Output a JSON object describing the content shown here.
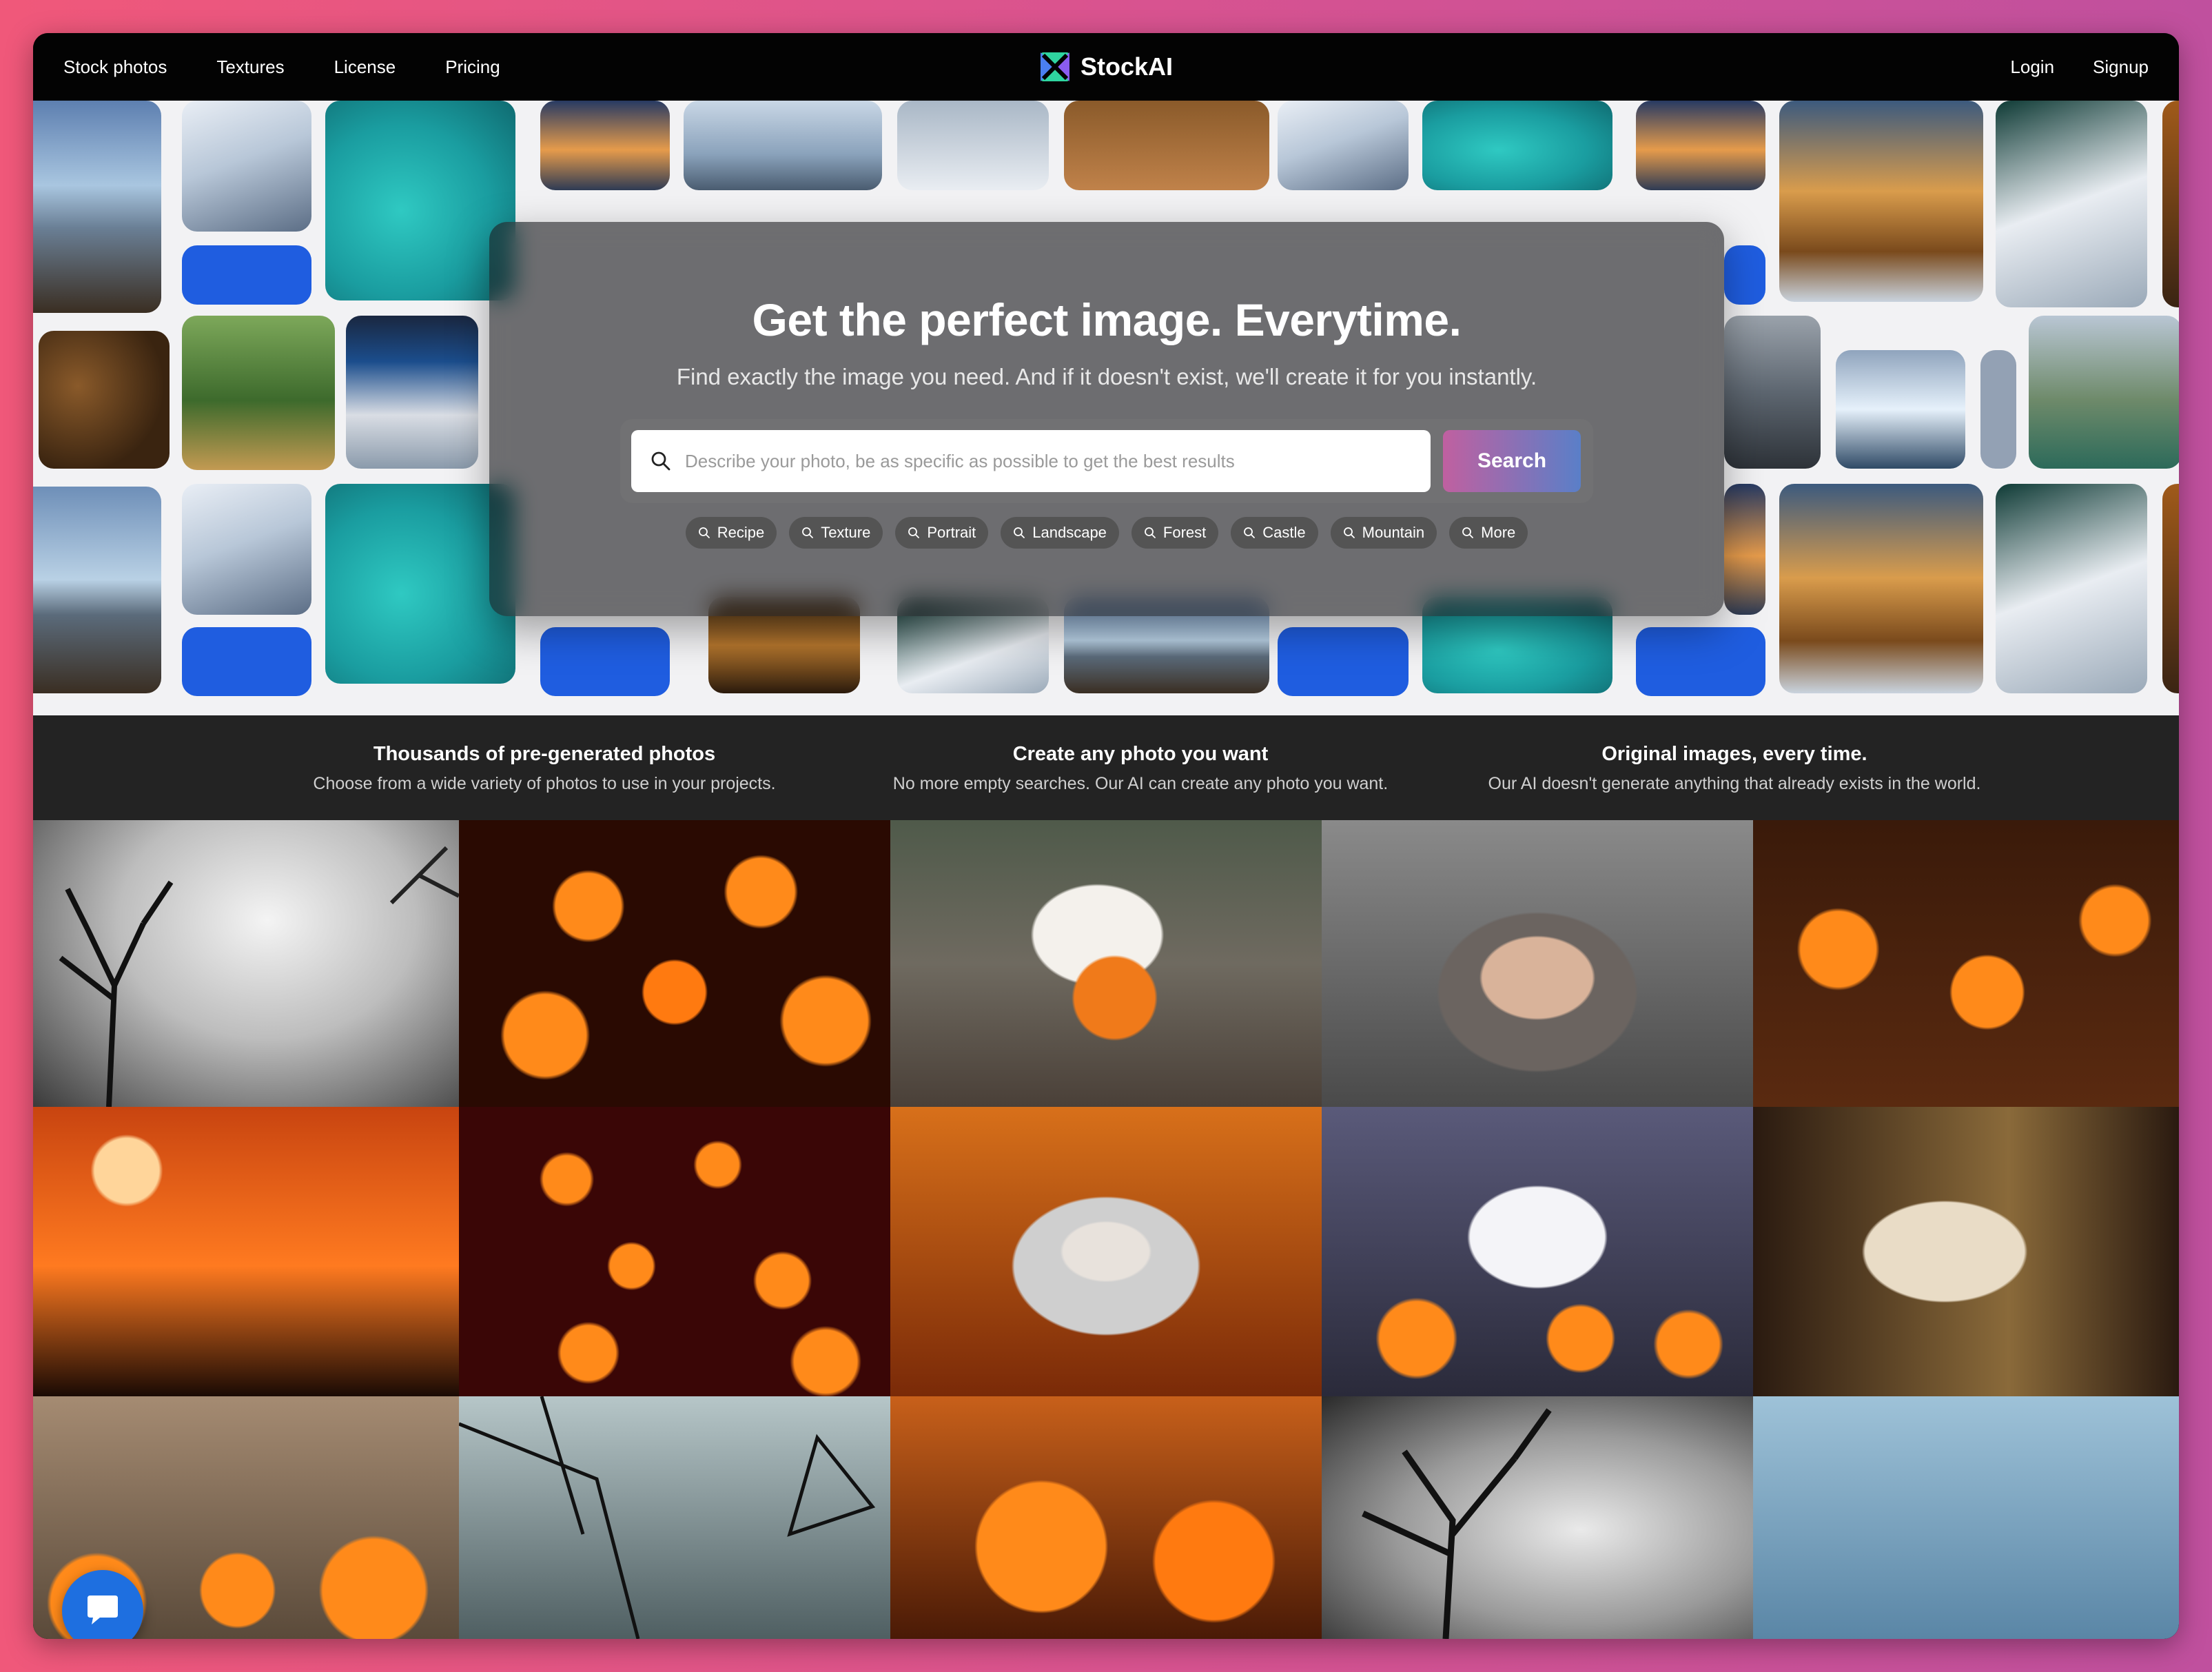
{
  "nav": {
    "links": [
      "Stock photos",
      "Textures",
      "License",
      "Pricing"
    ],
    "brand": "StockAI",
    "login": "Login",
    "signup": "Signup"
  },
  "hero": {
    "title": "Get the perfect image. Everytime.",
    "subtitle": "Find exactly the image you need. And if it doesn't exist, we'll create it for you instantly.",
    "search_placeholder": "Describe your photo, be as specific as possible to get the best results",
    "search_button": "Search",
    "chips": [
      "Recipe",
      "Texture",
      "Portrait",
      "Landscape",
      "Forest",
      "Castle",
      "Mountain",
      "More"
    ]
  },
  "features": [
    {
      "title": "Thousands of pre-generated photos",
      "text": "Choose from a wide variety of photos to use in your projects."
    },
    {
      "title": "Create any photo you want",
      "text": "No more empty searches. Our AI can create any photo you want."
    },
    {
      "title": "Original images, every time.",
      "text": "Our AI doesn't generate anything that already exists in the world."
    }
  ],
  "colors": {
    "page_gradient_left": "#f0587a",
    "page_gradient_right": "#c0509e",
    "nav_bg": "#030303",
    "search_button_gradient": [
      "#c060a0",
      "#5a7fc8"
    ],
    "chat_button": "#1e6fe0"
  },
  "icons": [
    "stockai-logo-icon",
    "search-icon",
    "chat-icon"
  ]
}
